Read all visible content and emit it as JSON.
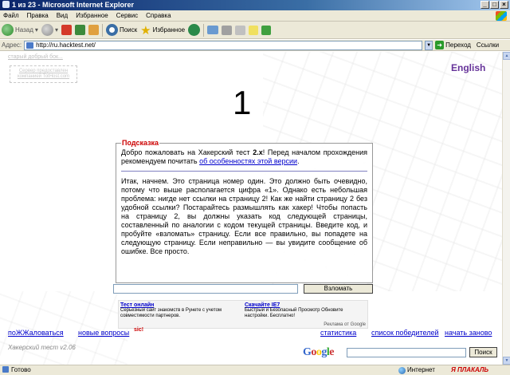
{
  "window": {
    "title": "1 из 23 - Microsoft Internet Explorer"
  },
  "menu": {
    "items": [
      "Файл",
      "Правка",
      "Вид",
      "Избранное",
      "Сервис",
      "Справка"
    ]
  },
  "toolbar": {
    "back_label": "Назад",
    "search_label": "Поиск",
    "favorites_label": "Избранное"
  },
  "address": {
    "label": "Адрес:",
    "url": "http://ru.hacktest.net/",
    "go_label": "Переход",
    "links_label": "Ссылки"
  },
  "page": {
    "old_link": "старый добрый бок...",
    "server_note": "Сервер предоставлен компанией TotHost.com",
    "english_link": "English",
    "level_number": "1",
    "hint": {
      "title": "Подсказка",
      "intro_before": "Добро пожаловать на Хакерский тест ",
      "intro_version": "2.x",
      "intro_after": "! Перед началом прохождения рекомендуем почитать ",
      "intro_link": "об особенностях этой версии",
      "intro_end": ".",
      "body": "Итак, начнем. Это страница номер один. Это должно быть очевидно, потому что выше располагается цифра «1». Однако есть небольшая проблема: нигде нет ссылки на страницу 2! Как же найти страницу 2 без удобной ссылки? Постарайтесь размышлять как хакер! Чтобы попасть на страницу 2, вы должны указать код следующей страницы, составленный по аналогии с кодом текущей страницы. Введите код, и пробуйте «взломать» страницу. Если все правильно, вы попадете на следующую страницу. Если неправильно — вы увидите сообщение об ошибке. Все просто."
    },
    "submit_label": "Взломать",
    "ads": [
      {
        "title": "Тест онлайн",
        "text": "Серьезный сайт знакомств в Рунете с учетом совместимости партнеров."
      },
      {
        "title": "Скачайте IE7",
        "text": "Быстрый и Безопасный Просмотр Обновите настройки. Бесплатно!"
      }
    ],
    "ads_attribution": "Реклама от Google",
    "footer_links": {
      "complain": "поЖЖаловаться",
      "new_questions": "новые вопросы",
      "sic": "sic!",
      "stats": "статистика",
      "winners": "список победителей",
      "restart": "начать заново"
    },
    "version": "Хакерский тест v2.06",
    "google_search_label": "Поиск"
  },
  "status": {
    "text": "Готово",
    "zone": "Интернет",
    "watermark": "Я ПЛАКАЛЬ"
  },
  "colors": {
    "link": "#0000cc",
    "accent_red": "#cc0000",
    "english_purple": "#663399"
  }
}
